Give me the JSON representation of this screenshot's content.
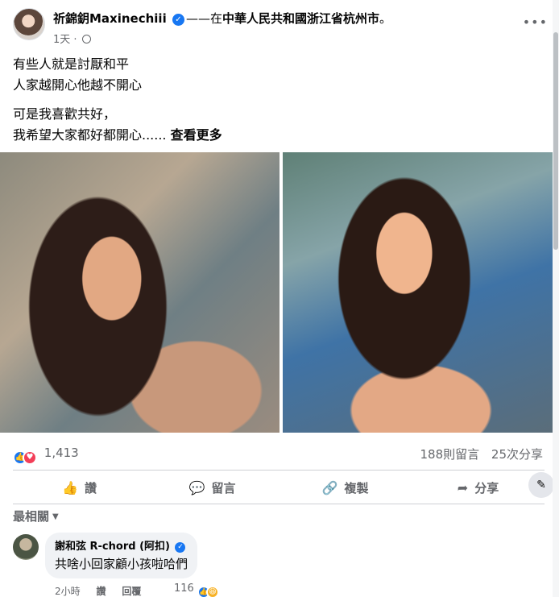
{
  "post": {
    "author": "祈錦鈅Maxinechiii",
    "location_prefix": "——在",
    "location": "中華人民共和國浙江省杭州市",
    "location_suffix": "。",
    "time": "1天",
    "meta_separator": "·",
    "more_glyph": "•••",
    "text_lines": [
      "有些人就是討厭和平",
      "人家越開心他越不開心",
      "可是我喜歡共好，",
      "我希望大家都好都開心......"
    ],
    "see_more": "查看更多",
    "reaction_count": "1,413",
    "comments_count": "188則留言",
    "shares_count": "25次分享"
  },
  "actions": {
    "like": "讚",
    "comment": "留言",
    "copy": "複製",
    "share": "分享"
  },
  "comments": {
    "sort_label": "最相關",
    "first": {
      "author": "謝和弦 R-chord (阿扣)",
      "text": "共啥小回家顧小孩啦哈們",
      "time": "2小時",
      "like": "讚",
      "reply": "回覆",
      "reaction_count": "116"
    }
  },
  "icons": {
    "verified": "verified-badge-icon",
    "globe": "globe-icon",
    "like": "thumbs-up-icon",
    "love": "heart-icon",
    "haha": "laughing-face-icon",
    "comment": "speech-bubble-icon",
    "copy": "link-icon",
    "share": "share-arrow-icon"
  },
  "colors": {
    "accent": "#1877f2",
    "love": "#f33e58",
    "haha": "#f7b125",
    "secondary_text": "#65676b",
    "bubble_bg": "#f0f2f5"
  }
}
